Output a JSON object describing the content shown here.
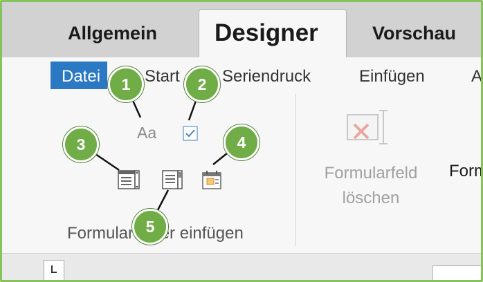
{
  "tabs": {
    "allgemein": "Allgemein",
    "designer": "Designer",
    "vorschau": "Vorschau"
  },
  "menu": {
    "datei": "Datei",
    "start": "Start",
    "seriendruck": "Seriendruck",
    "einfuegen": "Einfügen",
    "cutoff": "A"
  },
  "ribbon": {
    "aa_icon_text": "Aa",
    "group_label": "Formularfelder einfügen",
    "delete_label_line1": "Formularfeld",
    "delete_label_line2": "löschen",
    "cutoff_label": "Form"
  },
  "markers": {
    "m1": "1",
    "m2": "2",
    "m3": "3",
    "m4": "4",
    "m5": "5"
  },
  "colors": {
    "frame": "#86c35b",
    "marker": "#70ad47",
    "datei_bg": "#2b79c2",
    "tabstrip_bg": "#d2d2d2"
  }
}
